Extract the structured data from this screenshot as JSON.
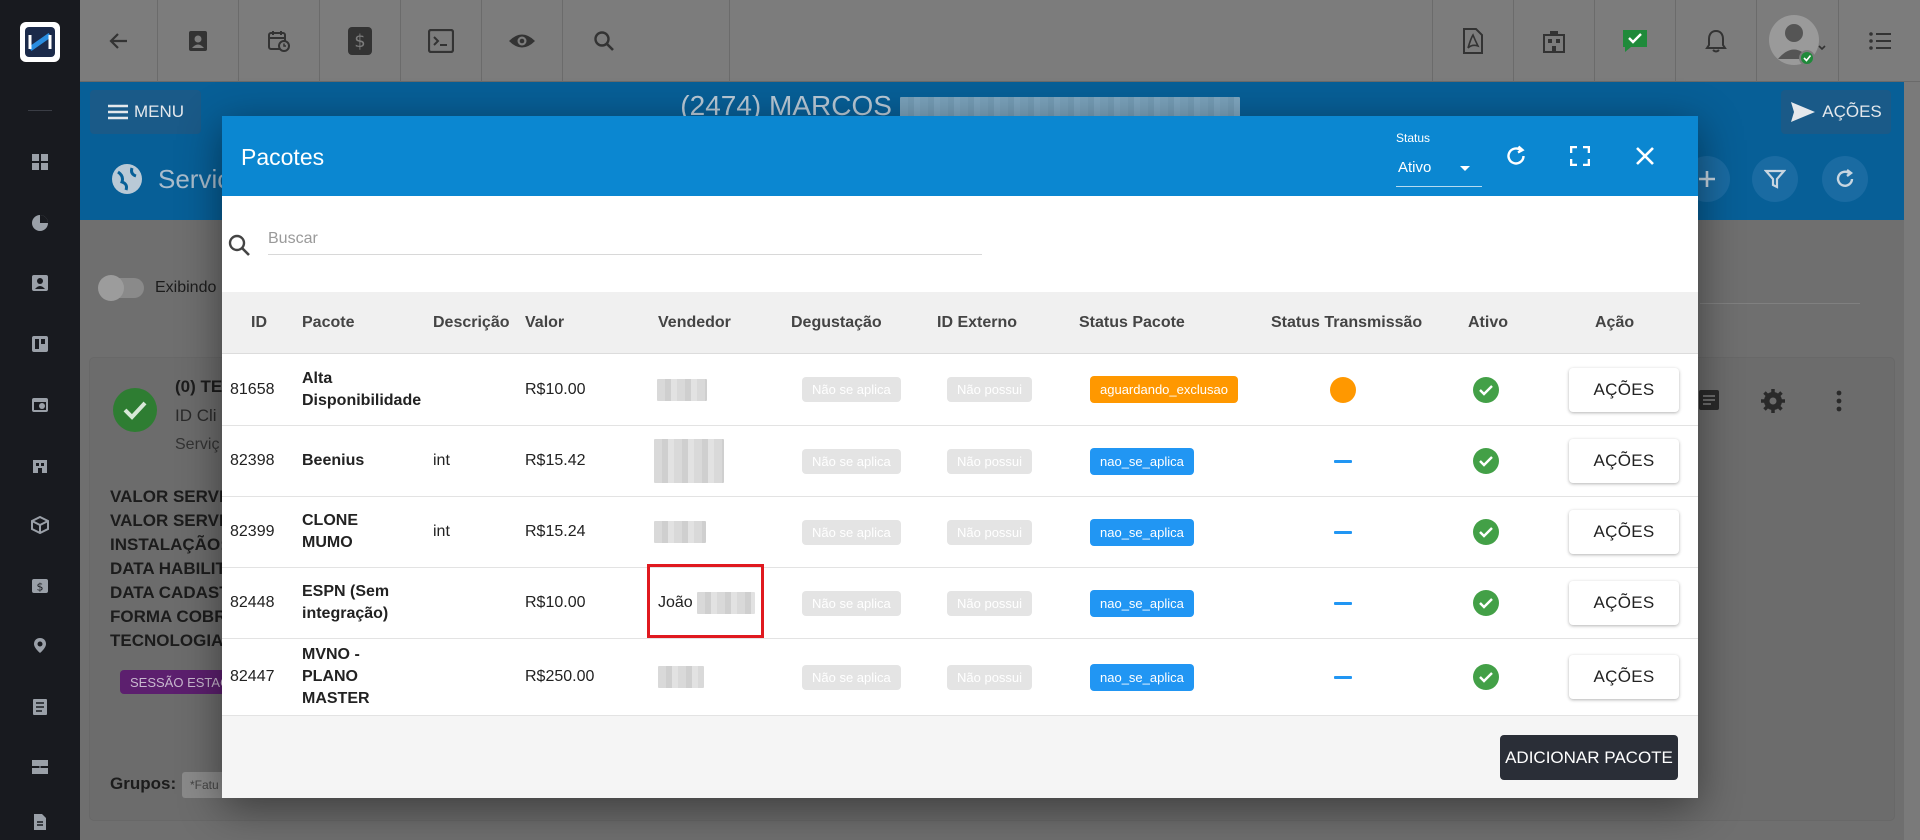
{
  "page": {
    "title": "(2474) MARCOS",
    "menu_label": "MENU",
    "acoes_label": "AÇÕES",
    "section_title": "Serviç",
    "toggle_label": "Exibindo",
    "service_name": "(0) TE",
    "service_id_label": "ID Cli",
    "service_sub": "Serviç",
    "info_lines": [
      "VALOR SERVIC",
      "VALOR SERVIC",
      "INSTALAÇÃO:",
      "DATA HABILIT",
      "DATA CADAST",
      "FORMA COBRA",
      "TECNOLOGIA"
    ],
    "sessao_badge": "SESSÃO ESTAC",
    "grupos_label": "Grupos:",
    "grupos_tag": "*Fatu"
  },
  "modal": {
    "title": "Pacotes",
    "status_label": "Status",
    "status_value": "Ativo",
    "search_placeholder": "Buscar",
    "columns": [
      "ID",
      "Pacote",
      "Descrição",
      "Valor",
      "Vendedor",
      "Degustação",
      "ID Externo",
      "Status Pacote",
      "Status Transmissão",
      "Ativo",
      "Ação"
    ],
    "rows": [
      {
        "id": "81658",
        "pacote": "Alta Disponibilidade",
        "descricao": "",
        "valor": "R$10.00",
        "vendedor": "",
        "degustacao": "Não se aplica",
        "id_externo": "Não possui",
        "status_pacote": "aguardando_exclusao",
        "status_color": "#ff9800",
        "transmissao": "orange-dot",
        "ativo": "check-icon",
        "acao": "AÇÕES"
      },
      {
        "id": "82398",
        "pacote": "Beenius",
        "descricao": "int",
        "valor": "R$15.42",
        "vendedor": "",
        "degustacao": "Não se aplica",
        "id_externo": "Não possui",
        "status_pacote": "nao_se_aplica",
        "status_color": "#2196f3",
        "transmissao": "dash",
        "ativo": "check-icon",
        "acao": "AÇÕES"
      },
      {
        "id": "82399",
        "pacote": "CLONE MUMO",
        "descricao": "int",
        "valor": "R$15.24",
        "vendedor": "",
        "degustacao": "Não se aplica",
        "id_externo": "Não possui",
        "status_pacote": "nao_se_aplica",
        "status_color": "#2196f3",
        "transmissao": "dash",
        "ativo": "check-icon",
        "acao": "AÇÕES"
      },
      {
        "id": "82448",
        "pacote": "ESPN (Sem integração)",
        "descricao": "",
        "valor": "R$10.00",
        "vendedor": "João",
        "degustacao": "Não se aplica",
        "id_externo": "Não possui",
        "status_pacote": "nao_se_aplica",
        "status_color": "#2196f3",
        "transmissao": "dash",
        "ativo": "check-icon",
        "acao": "AÇÕES"
      },
      {
        "id": "82447",
        "pacote": "MVNO - PLANO MASTER",
        "descricao": "",
        "valor": "R$250.00",
        "vendedor": "",
        "degustacao": "Não se aplica",
        "id_externo": "Não possui",
        "status_pacote": "nao_se_aplica",
        "status_color": "#2196f3",
        "transmissao": "dash",
        "ativo": "check-icon",
        "acao": "AÇÕES"
      }
    ],
    "add_button": "ADICIONAR PACOTE"
  },
  "colors": {
    "header_blue": "#0b87d1",
    "status_orange": "#ff9800",
    "status_blue": "#2196f3",
    "active_green": "#43a047",
    "highlight_red": "#e0191f",
    "add_button_dark": "#2a2e37"
  },
  "icons": {
    "topbar": [
      "back-arrow-icon",
      "contact-icon",
      "calendar-clock-icon",
      "dollar-icon",
      "terminal-icon",
      "eye-icon",
      "search-icon",
      "pdf-icon",
      "building-icon",
      "chat-check-icon",
      "bell-icon",
      "user-avatar-icon",
      "list-icon"
    ],
    "rail": [
      "dashboard-icon",
      "pie-chart-icon",
      "contact-card-icon",
      "board-icon",
      "calendar-icon",
      "building-icon",
      "box-icon",
      "money-icon",
      "location-icon",
      "document-icon",
      "server-icon",
      "file-icon"
    ]
  }
}
